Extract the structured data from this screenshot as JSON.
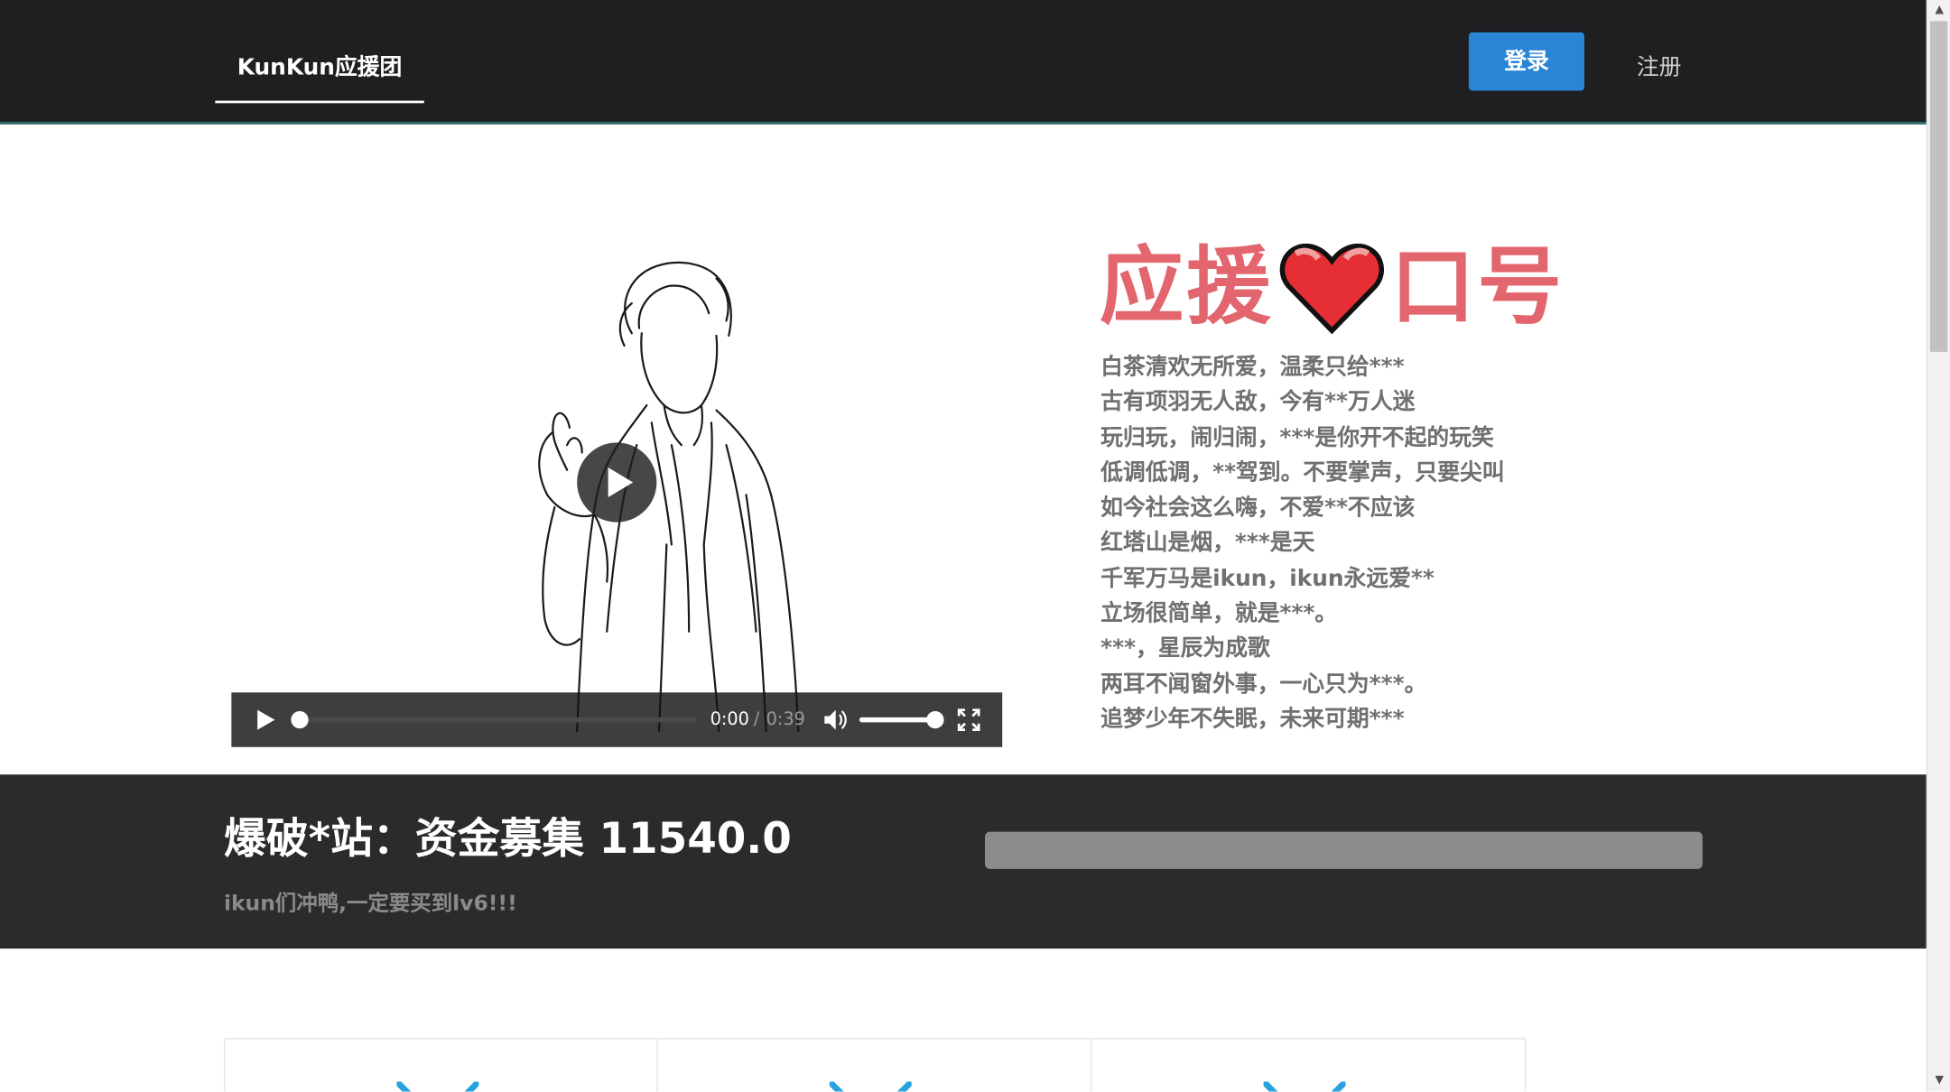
{
  "nav": {
    "brand": "KunKun应援团",
    "login": "登录",
    "register": "注册"
  },
  "video": {
    "current_time": "0:00",
    "separator": "/",
    "duration": "0:39",
    "progress": 0,
    "volume": 1.0
  },
  "slogan": {
    "title_left": "应援",
    "title_right": "口号",
    "heart_icon": "heart-icon",
    "lines": [
      "白茶清欢无所爱，温柔只给***",
      "古有项羽无人敌，今有**万人迷",
      "玩归玩，闹归闹，***是你开不起的玩笑",
      "低调低调，**驾到。不要掌声，只要尖叫",
      "如今社会这么嗨，不爱**不应该",
      "红塔山是烟，***是天",
      "千军万马是ikun，ikun永远爱**",
      "立场很简单，就是***。",
      "***，星辰为成歌",
      "两耳不闻窗外事，一心只为***。",
      "追梦少年不失眠，未来可期***"
    ]
  },
  "funding": {
    "title": "爆破*站：资金募集 11540.0",
    "subtitle": "ikun们冲鸭,一定要买到lv6!!!"
  },
  "colors": {
    "navbar_bg": "#1f1f21",
    "login_bg": "#2a85d6",
    "slogan_red": "#e3656d",
    "band_bg": "#2b2b2b",
    "card_icon": "#29a3e0"
  },
  "cards": [
    {
      "icon": "card-icon"
    },
    {
      "icon": "card-icon"
    },
    {
      "icon": "card-icon"
    }
  ]
}
